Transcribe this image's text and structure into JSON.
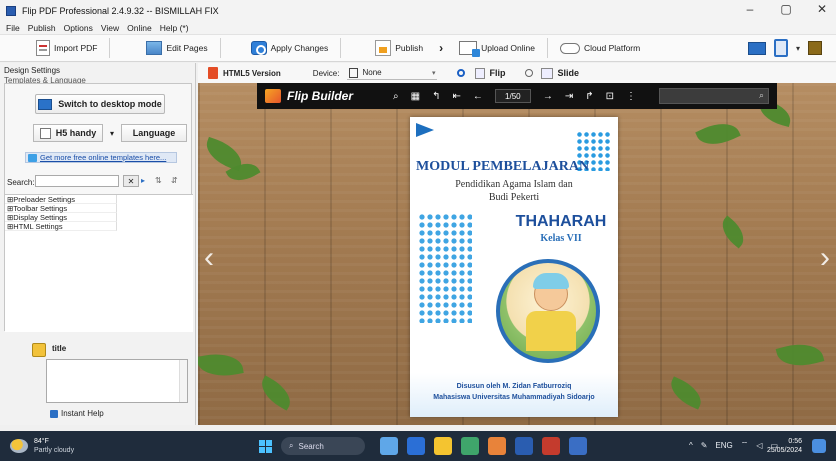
{
  "window": {
    "title": "Flip PDF Professional 2.4.9.32 -- BISMILLAH FIX",
    "controls": {
      "minimize": "–",
      "maximize": "▢",
      "close": "✕"
    }
  },
  "menu": [
    "File",
    "Publish",
    "Options",
    "View",
    "Online",
    "Help (*)"
  ],
  "toolbar": {
    "import_pdf": "Import PDF",
    "edit_pages": "Edit Pages",
    "apply_changes": "Apply Changes",
    "publish": "Publish",
    "upload_online": "Upload Online",
    "cloud_platform": "Cloud Platform"
  },
  "left_panel": {
    "tab": "Design Settings",
    "section": "Templates & Language",
    "desktop_mode": "Switch to desktop mode",
    "template": "H5 handy",
    "language": "Language",
    "more_templates": "Get more free online templates here...",
    "search_label": "Search:",
    "search_value": "",
    "tree": [
      "⊞Preloader Settings",
      "⊞Toolbar Settings",
      "⊞Display Settings",
      "⊞HTML Settings"
    ],
    "title_label": "title",
    "instant_help": "Instant Help"
  },
  "view_bar": {
    "html5": "HTML5 Version",
    "device_label": "Device:",
    "device_value": "None",
    "flip": "Flip",
    "slide": "Slide",
    "flip_selected": true
  },
  "flip_builder": {
    "name": "Flip Builder",
    "page_indicator": "1/50",
    "search_placeholder": ""
  },
  "book": {
    "title": "MODUL PEMBELAJARAN",
    "subtitle1": "Pendidikan Agama Islam dan",
    "subtitle2": "Budi Pekerti",
    "topic": "THAHARAH",
    "grade": "Kelas VII",
    "author": "Disusun oleh M. Zidan Fatburroziq",
    "affiliation": "Mahasiswa Universitas Muhammadiyah Sidoarjo"
  },
  "taskbar": {
    "weather_temp": "84°F",
    "weather_desc": "Partly cloudy",
    "search": "Search",
    "lang": "ENG",
    "time": "0:56",
    "date": "25/05/2024"
  },
  "colors": {
    "accent": "#1d4f9c",
    "taskbar": "#1f2c3c",
    "flipbuilder_bar": "#111111"
  }
}
